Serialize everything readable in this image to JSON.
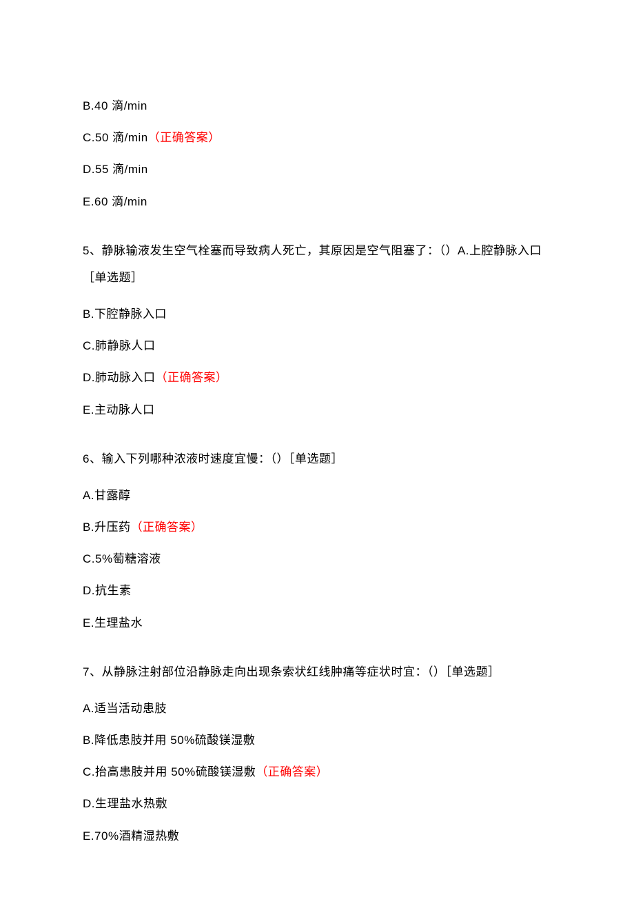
{
  "q4_remaining": {
    "options": {
      "b": "B.40 滴/min",
      "c": "C.50 滴/min",
      "c_answer": "（正确答案）",
      "d": "D.55 滴/min",
      "e": "E.60 滴/min"
    }
  },
  "q5": {
    "text": "5、静脉输液发生空气栓塞而导致病人死亡，其原因是空气阻塞了：（）A.上腔静脉入口［单选题］",
    "options": {
      "b": "B.下腔静脉入口",
      "c": "C.肺静脉人口",
      "d": "D.肺动脉入口",
      "d_answer": "（正确答案）",
      "e": "E.主动脉人口"
    }
  },
  "q6": {
    "text": "6、输入下列哪种浓液时速度宜慢：（）［单选题］",
    "options": {
      "a": "A.甘露醇",
      "b": "B.升压药",
      "b_answer": "（正确答案）",
      "c": "C.5%萄糖溶液",
      "d": "D.抗生素",
      "e": "E.生理盐水"
    }
  },
  "q7": {
    "text": "7、从静脉注射部位沿静脉走向出现条索状红线肿痛等症状时宜：（）［单选题］",
    "options": {
      "a": "A.适当活动患肢",
      "b": "B.降低患肢并用 50%硫酸镁湿敷",
      "c": "C.抬高患肢并用 50%硫酸镁湿敷",
      "c_answer": "（正确答案）",
      "d": "D.生理盐水热敷",
      "e": "E.70%酒精湿热敷"
    }
  }
}
